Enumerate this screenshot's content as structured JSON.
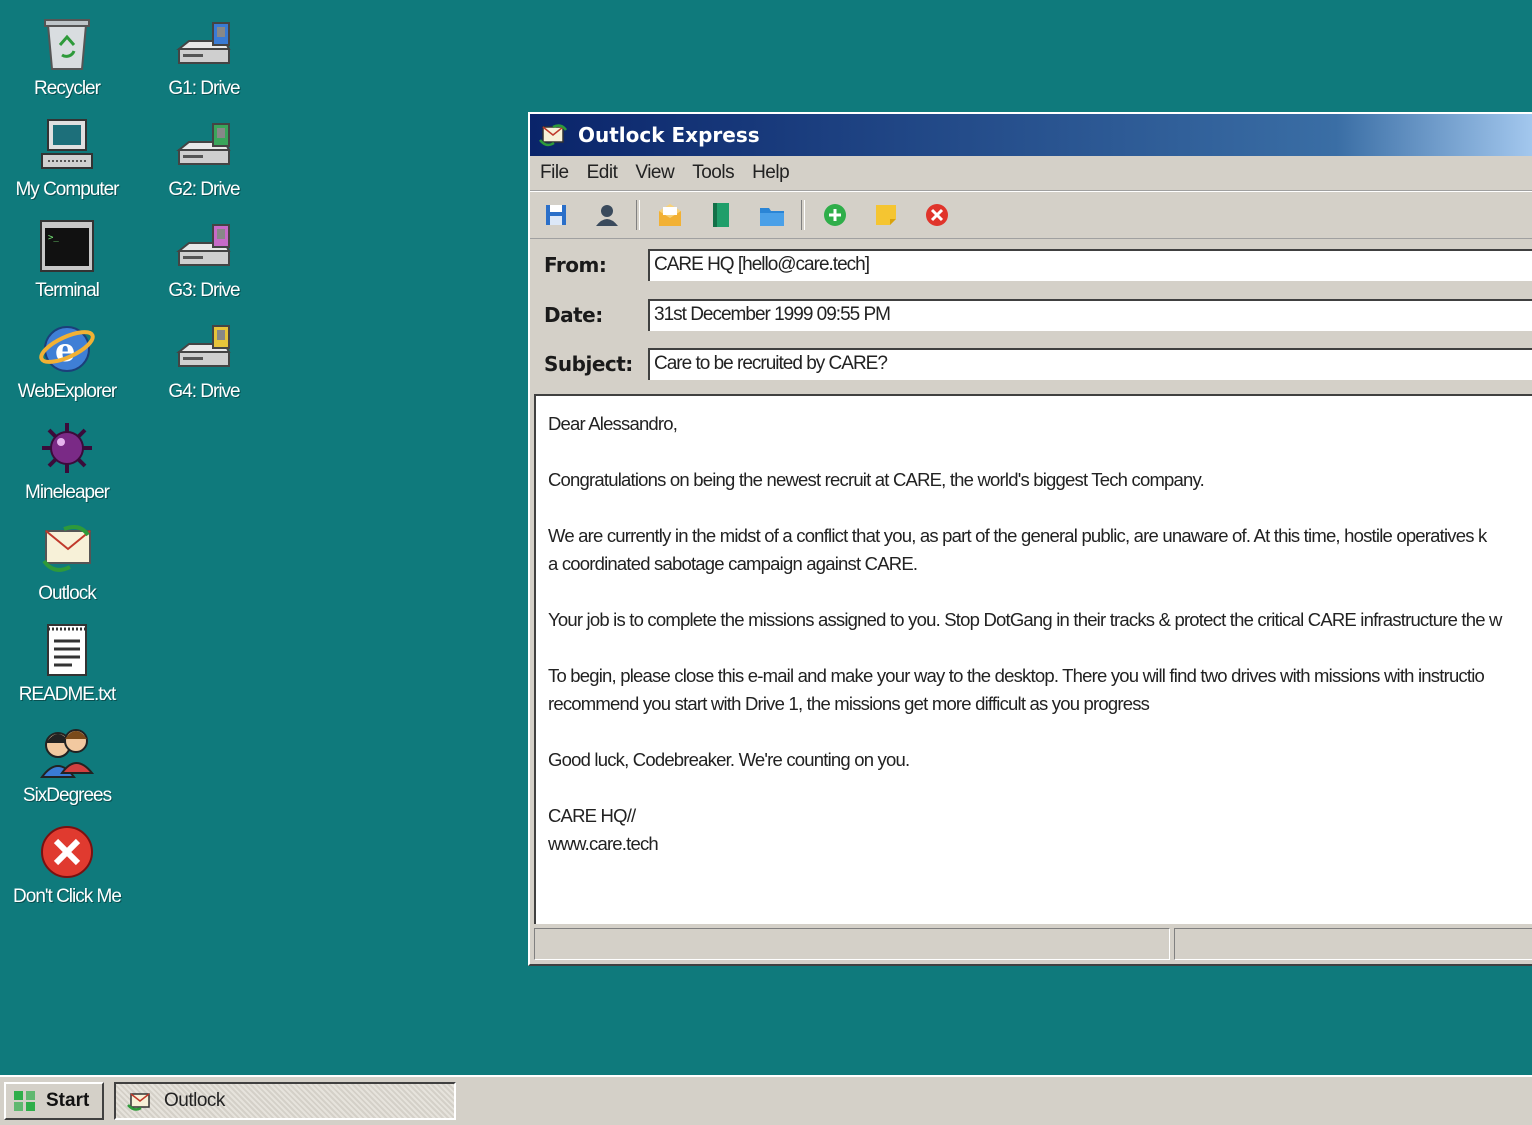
{
  "desktop": {
    "icons_left": [
      {
        "label": "Recycler",
        "icon": "recycle-bin-icon"
      },
      {
        "label": "My Computer",
        "icon": "computer-icon"
      },
      {
        "label": "Terminal",
        "icon": "terminal-icon"
      },
      {
        "label": "WebExplorer",
        "icon": "web-explorer-icon"
      },
      {
        "label": "Mineleaper",
        "icon": "mine-icon"
      },
      {
        "label": "Outlock",
        "icon": "mail-icon"
      },
      {
        "label": "README.txt",
        "icon": "text-file-icon"
      },
      {
        "label": "SixDegrees",
        "icon": "people-icon"
      },
      {
        "label": "Don't Click Me",
        "icon": "error-icon"
      }
    ],
    "icons_right": [
      {
        "label": "G1: Drive",
        "icon": "drive-icon",
        "color": "#3a7bd5"
      },
      {
        "label": "G2: Drive",
        "icon": "drive-icon",
        "color": "#3aa55a"
      },
      {
        "label": "G3: Drive",
        "icon": "drive-icon",
        "color": "#c86ac8"
      },
      {
        "label": "G4: Drive",
        "icon": "drive-icon",
        "color": "#e6c43a"
      }
    ]
  },
  "window": {
    "title": "Outlock Express",
    "menu": [
      "File",
      "Edit",
      "View",
      "Tools",
      "Help"
    ],
    "toolbar": [
      "save-icon",
      "contact-icon",
      "open-mail-icon",
      "book-icon",
      "folder-icon",
      "add-icon",
      "note-icon",
      "delete-icon"
    ],
    "headers": {
      "from_label": "From:",
      "from_value": "CARE HQ [hello@care.tech]",
      "date_label": "Date:",
      "date_value": "31st December 1999 09:55 PM",
      "subject_label": "Subject:",
      "subject_value": "Care to be recruited by CARE?"
    },
    "body": {
      "greeting": "Dear Alessandro,",
      "p1": "Congratulations on being the newest recruit at CARE, the world's biggest Tech company.",
      "p2_l1": "We are currently in the midst of a conflict that you, as part of the general public, are unaware of. At this time, hostile operatives k",
      "p2_l2": "a coordinated sabotage campaign against CARE.",
      "p3": "Your job is to complete the missions assigned to you. Stop DotGang in their tracks & protect the critical CARE infrastructure the w",
      "p4_l1": "To begin, please close this e-mail and make your way to the desktop. There you will find two drives with missions with instructio",
      "p4_l2": "recommend you start with Drive 1, the missions get more difficult as you progress",
      "p5": "Good luck, Codebreaker. We're counting on you.",
      "sig1": "CARE HQ//",
      "sig2": "www.care.tech"
    }
  },
  "taskbar": {
    "start_label": "Start",
    "task_label": "Outlock"
  },
  "colors": {
    "desktop": "#0f7a7c",
    "titlebar_start": "#0a246a",
    "titlebar_end": "#a6caf0",
    "chrome": "#d4d0c8"
  }
}
